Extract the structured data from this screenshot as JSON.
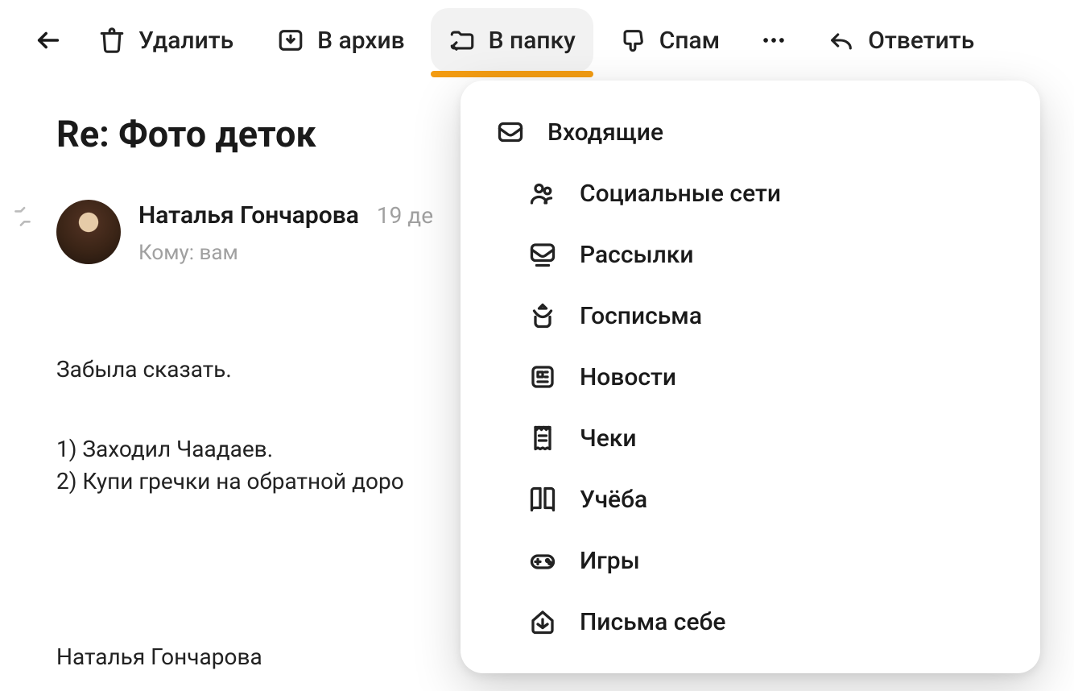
{
  "toolbar": {
    "back": "",
    "delete_label": "Удалить",
    "archive_label": "В архив",
    "move_label": "В папку",
    "spam_label": "Спам",
    "reply_label": "Ответить"
  },
  "email": {
    "subject": "Re: Фото деток",
    "sender_name": "Наталья Гончарова",
    "date": "19 де",
    "recipient": "Кому: вам",
    "body_line1": "Забыла сказать.",
    "body_line2": "1) Заходил Чаадаев.",
    "body_line3": "2) Купи гречки на обратной доро",
    "signature": "Наталья Гончарова"
  },
  "folders": [
    {
      "label": "Входящие",
      "icon": "inbox",
      "indent": false
    },
    {
      "label": "Социальные сети",
      "icon": "people",
      "indent": true
    },
    {
      "label": "Рассылки",
      "icon": "mailings",
      "indent": true
    },
    {
      "label": "Госписьма",
      "icon": "gov",
      "indent": true
    },
    {
      "label": "Новости",
      "icon": "news",
      "indent": true
    },
    {
      "label": "Чеки",
      "icon": "receipt",
      "indent": true
    },
    {
      "label": "Учёба",
      "icon": "book",
      "indent": true
    },
    {
      "label": "Игры",
      "icon": "game",
      "indent": true
    },
    {
      "label": "Письма себе",
      "icon": "self",
      "indent": true
    }
  ]
}
